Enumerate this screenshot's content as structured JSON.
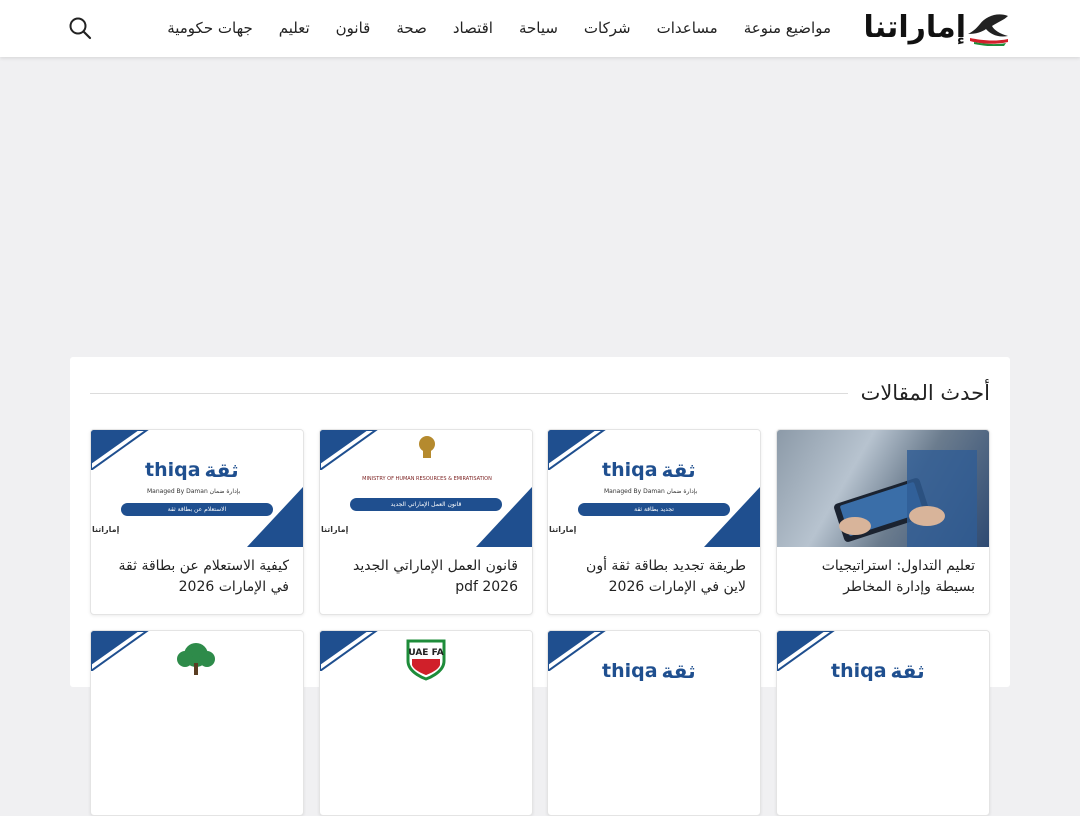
{
  "header": {
    "logo_text": "إماراتنا",
    "nav": [
      "جهات حكومية",
      "تعليم",
      "قانون",
      "صحة",
      "اقتصاد",
      "سياحة",
      "شركات",
      "مساعدات",
      "مواضيع منوعة"
    ],
    "search_icon": "search-icon"
  },
  "colors": {
    "page_background": "#f0f0f2",
    "brand_blue": "#1f4f8f",
    "logo_red": "#d0202a",
    "logo_green": "#1e8c3a"
  },
  "latest": {
    "title": "أحدث المقالات",
    "articles": [
      {
        "title": "تعليم التداول: استراتيجيات بسيطة وإدارة المخاطر",
        "thumb": "photo"
      },
      {
        "title": "طريقة تجديد بطاقة ثقة أون لاين في الإمارات 2026",
        "thumb": "thiqa",
        "thumb_ar": "ثقة",
        "thumb_en": "thiqa",
        "managed": "Managed By Daman بإدارة ضمان",
        "pill": "تجديد بطاقة ثقة"
      },
      {
        "title": "قانون العمل الإماراتي الجديد pdf 2026",
        "thumb": "mohre",
        "org": "MINISTRY OF HUMAN RESOURCES & EMIRATISATION",
        "pill": "قانون العمل الإماراتي الجديد"
      },
      {
        "title": "كيفية الاستعلام عن بطاقة ثقة في الإمارات 2026",
        "thumb": "thiqa",
        "thumb_ar": "ثقة",
        "thumb_en": "thiqa",
        "managed": "Managed By Daman بإدارة ضمان",
        "pill": "الاستعلام عن بطاقة ثقة"
      }
    ],
    "second_row_badge": "UAE FA",
    "thumb_brand": "إماراتنا"
  }
}
